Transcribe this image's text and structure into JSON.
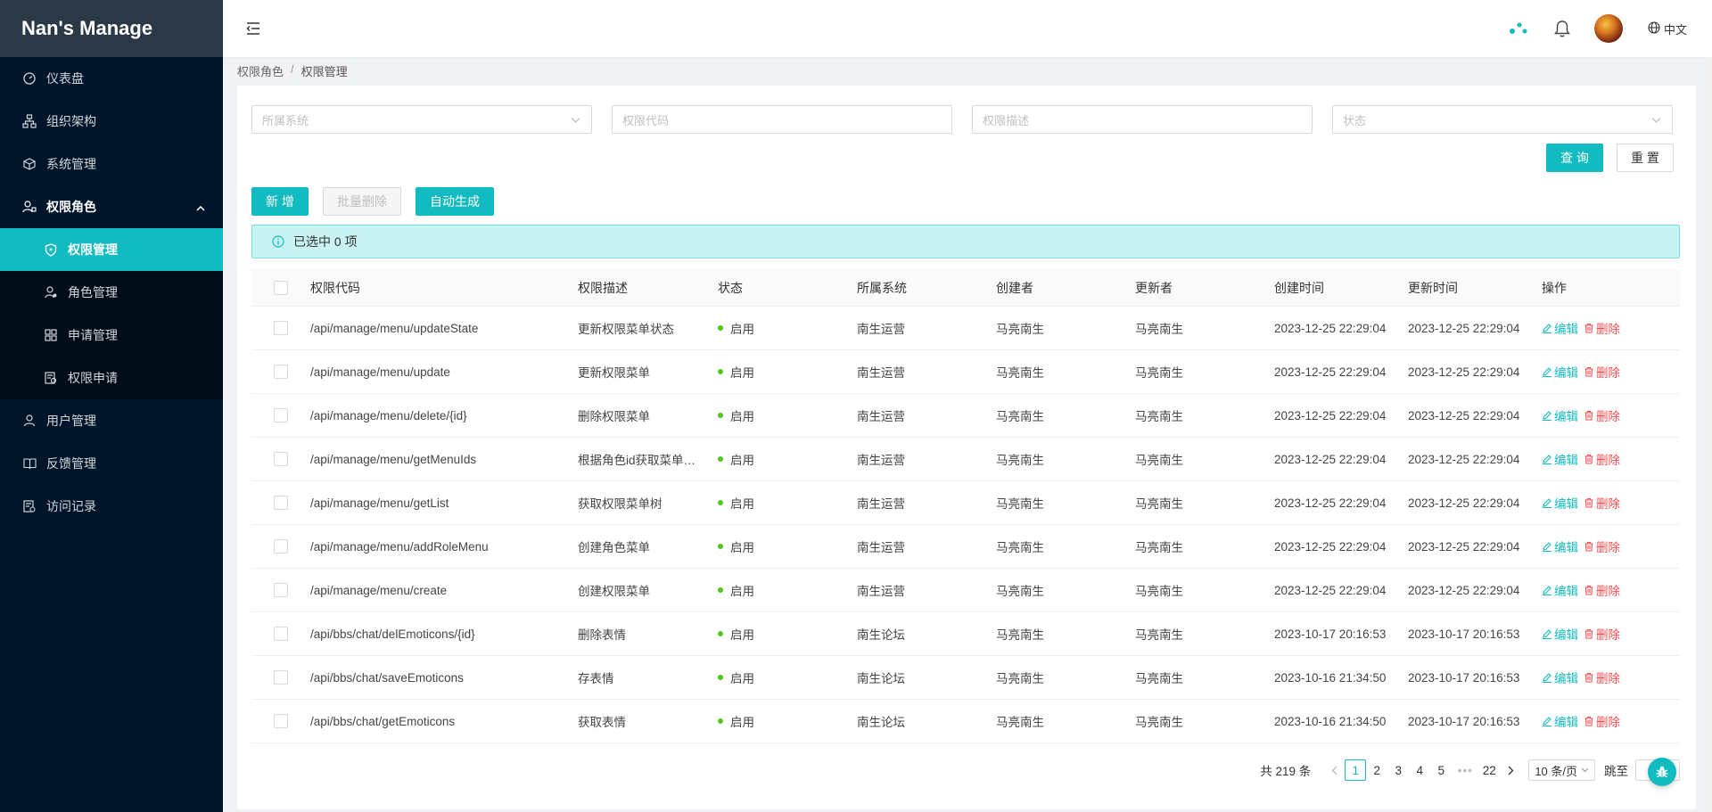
{
  "brand": "Nan's Manage",
  "sidebar": {
    "items": [
      {
        "label": "仪表盘",
        "icon": "dashboard-icon"
      },
      {
        "label": "组织架构",
        "icon": "org-icon"
      },
      {
        "label": "系统管理",
        "icon": "box-icon"
      },
      {
        "label": "权限角色",
        "icon": "user-lock-icon",
        "open": true
      },
      {
        "label": "用户管理",
        "icon": "user-icon"
      },
      {
        "label": "反馈管理",
        "icon": "book-icon"
      },
      {
        "label": "访问记录",
        "icon": "record-icon"
      }
    ],
    "submenu": [
      {
        "label": "权限管理",
        "icon": "shield-icon",
        "active": true
      },
      {
        "label": "角色管理",
        "icon": "role-icon"
      },
      {
        "label": "申请管理",
        "icon": "apps-icon"
      },
      {
        "label": "权限申请",
        "icon": "request-icon"
      }
    ]
  },
  "header": {
    "lang": "中文"
  },
  "breadcrumb": {
    "parent": "权限角色",
    "sep": "/",
    "current": "权限管理"
  },
  "search": {
    "system_placeholder": "所属系统",
    "code_placeholder": "权限代码",
    "desc_placeholder": "权限描述",
    "status_placeholder": "状态",
    "query_label": "查 询",
    "reset_label": "重 置"
  },
  "actions": {
    "add_label": "新 增",
    "batch_delete_label": "批量删除",
    "auto_generate_label": "自动生成"
  },
  "alert": {
    "text": "已选中 0 项"
  },
  "table": {
    "columns": [
      "权限代码",
      "权限描述",
      "状态",
      "所属系统",
      "创建者",
      "更新者",
      "创建时间",
      "更新时间",
      "操作"
    ],
    "edit_label": "编辑",
    "delete_label": "删除",
    "rows": [
      {
        "code": "/api/manage/menu/updateState",
        "desc": "更新权限菜单状态",
        "status": "启用",
        "system": "南生运营",
        "creator": "马亮南生",
        "updater": "马亮南生",
        "created": "2023-12-25 22:29:04",
        "updated": "2023-12-25 22:29:04"
      },
      {
        "code": "/api/manage/menu/update",
        "desc": "更新权限菜单",
        "status": "启用",
        "system": "南生运营",
        "creator": "马亮南生",
        "updater": "马亮南生",
        "created": "2023-12-25 22:29:04",
        "updated": "2023-12-25 22:29:04"
      },
      {
        "code": "/api/manage/menu/delete/{id}",
        "desc": "删除权限菜单",
        "status": "启用",
        "system": "南生运营",
        "creator": "马亮南生",
        "updater": "马亮南生",
        "created": "2023-12-25 22:29:04",
        "updated": "2023-12-25 22:29:04"
      },
      {
        "code": "/api/manage/menu/getMenuIds",
        "desc": "根据角色id获取菜单…",
        "status": "启用",
        "system": "南生运营",
        "creator": "马亮南生",
        "updater": "马亮南生",
        "created": "2023-12-25 22:29:04",
        "updated": "2023-12-25 22:29:04"
      },
      {
        "code": "/api/manage/menu/getList",
        "desc": "获取权限菜单树",
        "status": "启用",
        "system": "南生运营",
        "creator": "马亮南生",
        "updater": "马亮南生",
        "created": "2023-12-25 22:29:04",
        "updated": "2023-12-25 22:29:04"
      },
      {
        "code": "/api/manage/menu/addRoleMenu",
        "desc": "创建角色菜单",
        "status": "启用",
        "system": "南生运营",
        "creator": "马亮南生",
        "updater": "马亮南生",
        "created": "2023-12-25 22:29:04",
        "updated": "2023-12-25 22:29:04"
      },
      {
        "code": "/api/manage/menu/create",
        "desc": "创建权限菜单",
        "status": "启用",
        "system": "南生运营",
        "creator": "马亮南生",
        "updater": "马亮南生",
        "created": "2023-12-25 22:29:04",
        "updated": "2023-12-25 22:29:04"
      },
      {
        "code": "/api/bbs/chat/delEmoticons/{id}",
        "desc": "删除表情",
        "status": "启用",
        "system": "南生论坛",
        "creator": "马亮南生",
        "updater": "马亮南生",
        "created": "2023-10-17 20:16:53",
        "updated": "2023-10-17 20:16:53"
      },
      {
        "code": "/api/bbs/chat/saveEmoticons",
        "desc": "存表情",
        "status": "启用",
        "system": "南生论坛",
        "creator": "马亮南生",
        "updater": "马亮南生",
        "created": "2023-10-16 21:34:50",
        "updated": "2023-10-17 20:16:53"
      },
      {
        "code": "/api/bbs/chat/getEmoticons",
        "desc": "获取表情",
        "status": "启用",
        "system": "南生论坛",
        "creator": "马亮南生",
        "updater": "马亮南生",
        "created": "2023-10-16 21:34:50",
        "updated": "2023-10-17 20:16:53"
      }
    ]
  },
  "pagination": {
    "total": "共 219 条",
    "pages": [
      "1",
      "2",
      "3",
      "4",
      "5"
    ],
    "ellipsis": "•••",
    "last": "22",
    "page_size": "10 条/页",
    "jump_label": "跳至"
  },
  "colors": {
    "accent": "#12bbc0",
    "sidebar_bg": "#001529",
    "danger": "#ff4d4f",
    "success": "#52c41a"
  }
}
